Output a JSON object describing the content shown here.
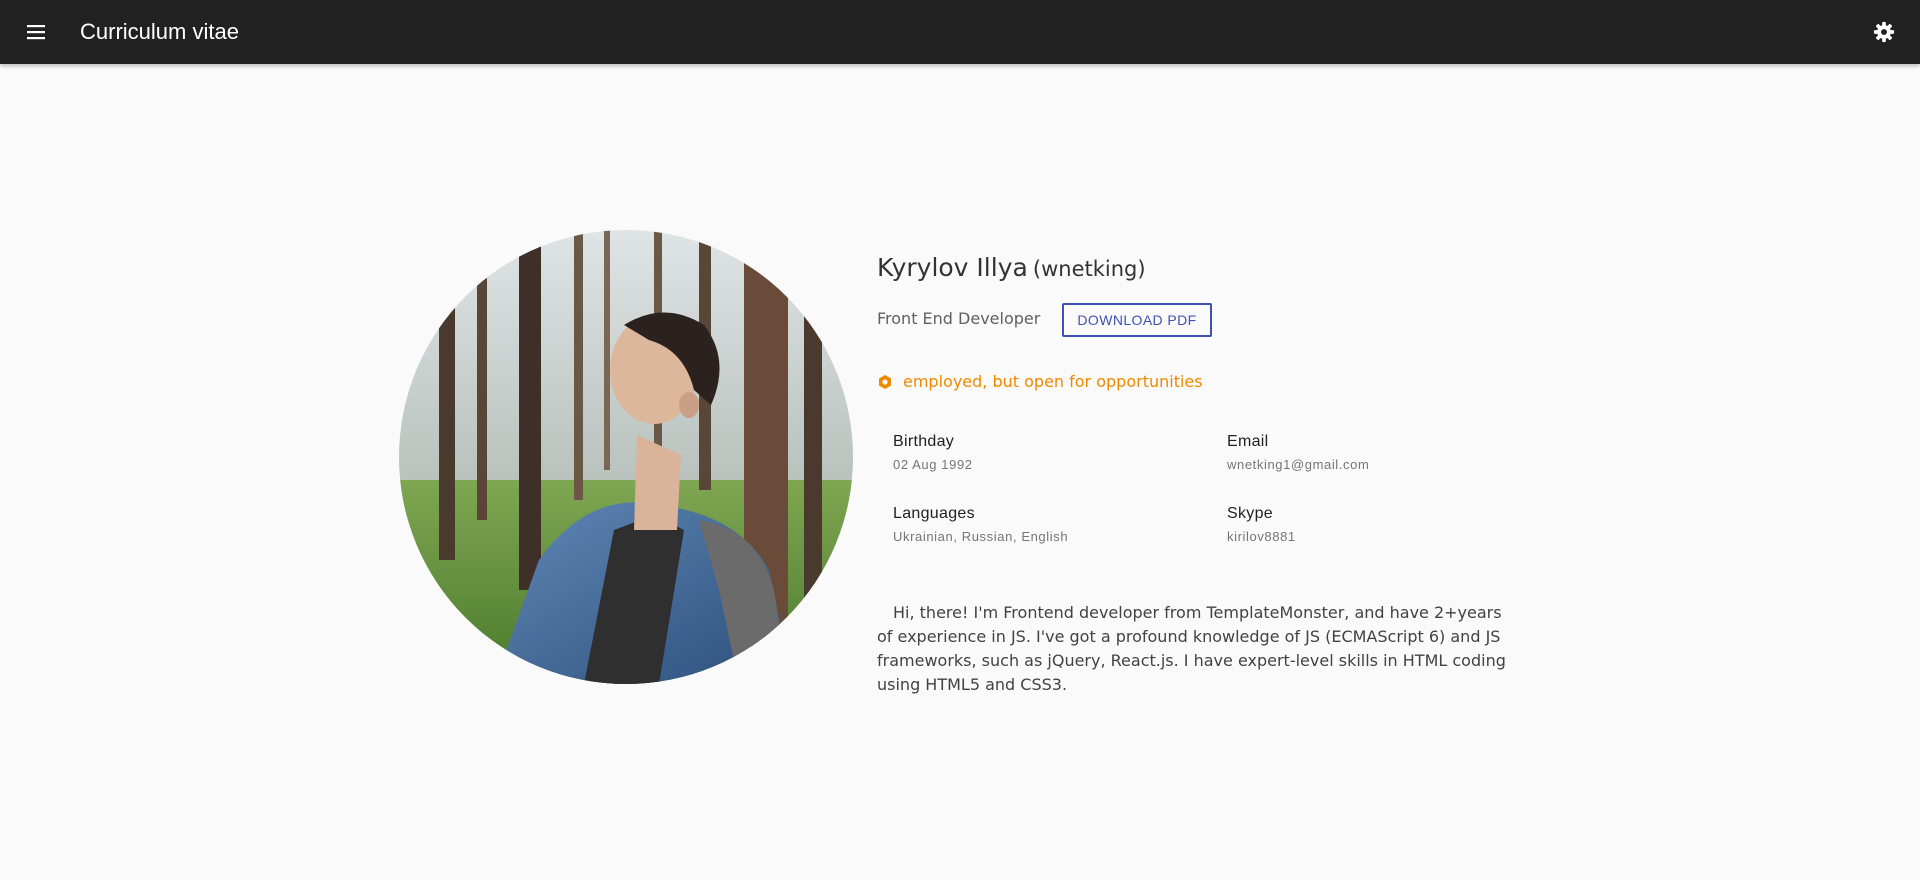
{
  "app": {
    "title": "Curriculum vitae"
  },
  "icons": {
    "menu": "menu-icon",
    "settings": "gear-icon",
    "status": "status-dot-icon"
  },
  "colors": {
    "appbar": "#212121",
    "accent": "#3f51b5",
    "status": "#ef8a00",
    "background": "#fafafa"
  },
  "profile": {
    "name": "Kyrylov Illya",
    "nickname": "(wnetking)",
    "role": "Front End Developer",
    "download_label": "DOWNLOAD PDF",
    "status": "employed, but open for opportunities",
    "info": {
      "birthday": {
        "label": "Birthday",
        "value": "02 Aug 1992"
      },
      "email": {
        "label": "Email",
        "value": "wnetking1@gmail.com"
      },
      "languages": {
        "label": "Languages",
        "value": "Ukrainian, Russian, English"
      },
      "skype": {
        "label": "Skype",
        "value": "kirilov8881"
      }
    },
    "bio": "Hi, there! I'm Frontend developer from TemplateMonster, and have 2+years of experience in JS. I've got a profound knowledge of JS (ECMAScript 6) and JS frameworks, such as jQuery, React.js. I have expert-level skills in HTML coding using HTML5 and CSS3."
  }
}
